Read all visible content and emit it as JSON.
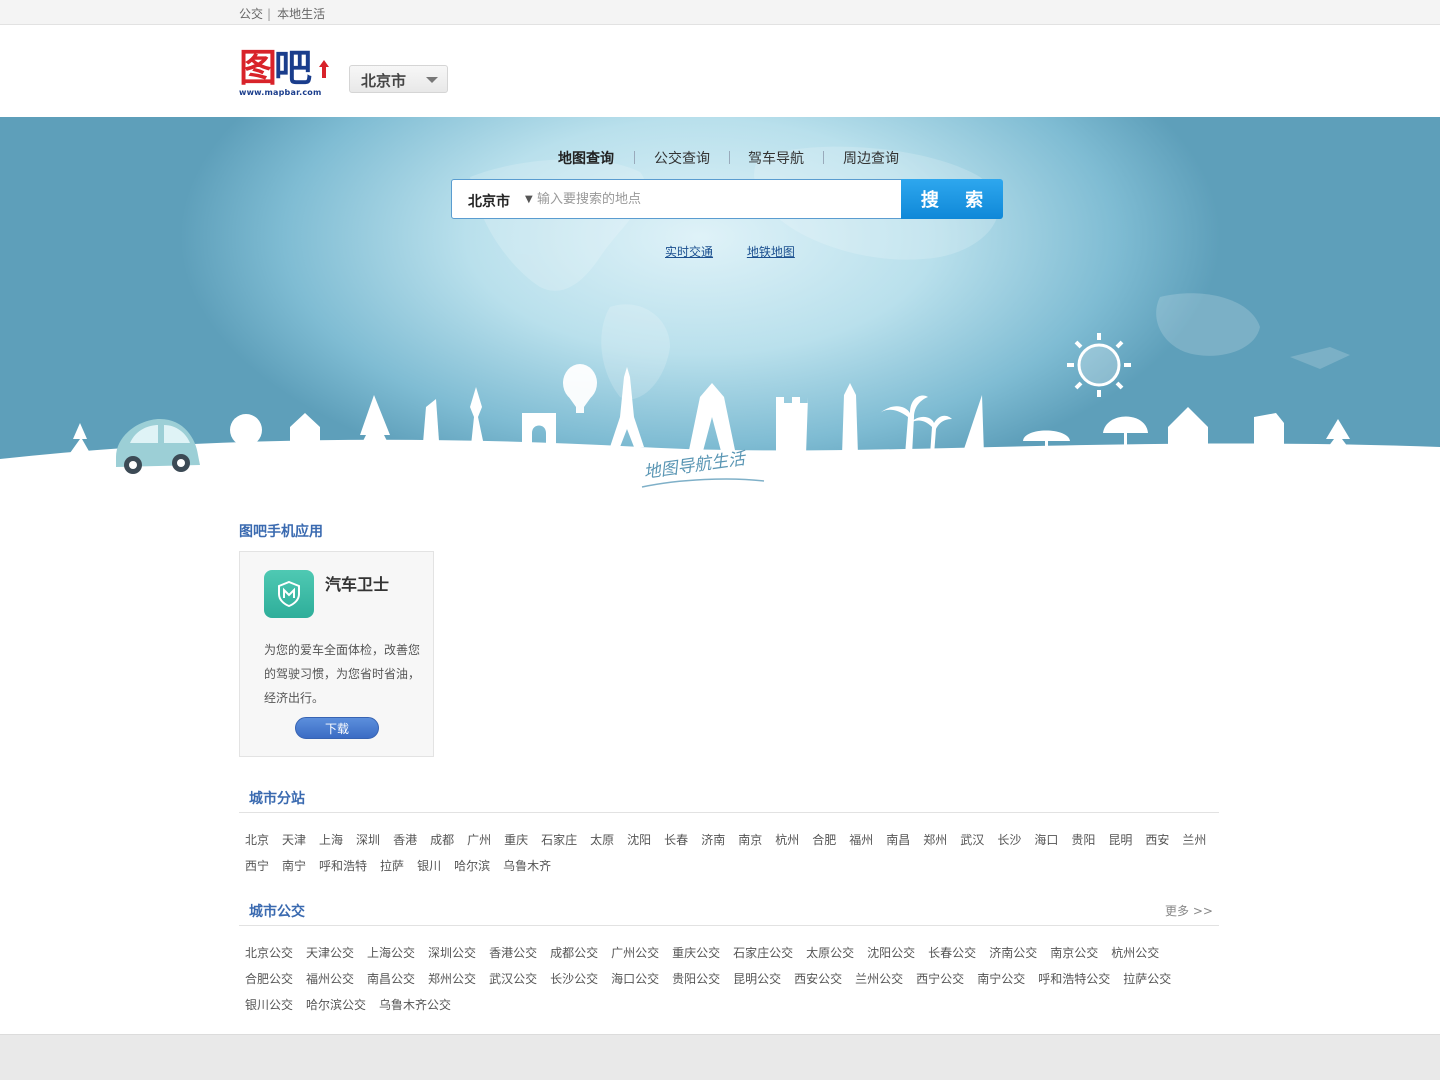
{
  "topbar": {
    "links": [
      "公交",
      "本地生活"
    ],
    "separator": "|"
  },
  "header": {
    "logo": {
      "text_tu": "图",
      "text_ba": "吧",
      "url_text": "www.mapbar.com"
    },
    "city_selector": {
      "value": "北京市"
    }
  },
  "hero": {
    "tabs": [
      "地图查询",
      "公交查询",
      "驾车导航",
      "周边查询"
    ],
    "active_tab": "地图查询",
    "search": {
      "city": "北京市",
      "placeholder": "输入要搜索的地点",
      "button_label": "搜 索"
    },
    "quick_links": [
      "实时交通",
      "地铁地图"
    ],
    "slogan": "地图导航生活"
  },
  "apps": {
    "title": "图吧手机应用",
    "card": {
      "icon": "shield-m-icon",
      "name": "汽车卫士",
      "description": "为您的爱车全面体检，改善您的驾驶习惯，为您省时省油，经济出行。",
      "download_label": "下载"
    }
  },
  "city_stations": {
    "title": "城市分站",
    "rows": [
      [
        "北京",
        "天津",
        "上海",
        "深圳",
        "香港",
        "成都",
        "广州",
        "重庆",
        "石家庄",
        "太原",
        "沈阳",
        "长春",
        "济南",
        "南京",
        "杭州",
        "合肥",
        "福州",
        "南昌",
        "郑州",
        "武汉",
        "长沙",
        "海口",
        "贵阳",
        "昆明",
        "西安",
        "兰州"
      ],
      [
        "西宁",
        "南宁",
        "呼和浩特",
        "拉萨",
        "银川",
        "哈尔滨",
        "乌鲁木齐"
      ]
    ]
  },
  "city_bus": {
    "title": "城市公交",
    "more_label": "更多 >>",
    "rows": [
      [
        "北京公交",
        "天津公交",
        "上海公交",
        "深圳公交",
        "香港公交",
        "成都公交",
        "广州公交",
        "重庆公交",
        "石家庄公交",
        "太原公交",
        "沈阳公交",
        "长春公交",
        "济南公交",
        "南京公交",
        "杭州公交"
      ],
      [
        "合肥公交",
        "福州公交",
        "南昌公交",
        "郑州公交",
        "武汉公交",
        "长沙公交",
        "海口公交",
        "贵阳公交",
        "昆明公交",
        "西安公交",
        "兰州公交",
        "西宁公交",
        "南宁公交",
        "呼和浩特公交",
        "拉萨公交"
      ],
      [
        "银川公交",
        "哈尔滨公交",
        "乌鲁木齐公交"
      ]
    ]
  },
  "colors": {
    "brand_red": "#d8232a",
    "brand_blue": "#1a3d8c",
    "search_button": "#1a96e4",
    "section_title": "#3a6ab0",
    "app_icon": "#3dbba6"
  }
}
